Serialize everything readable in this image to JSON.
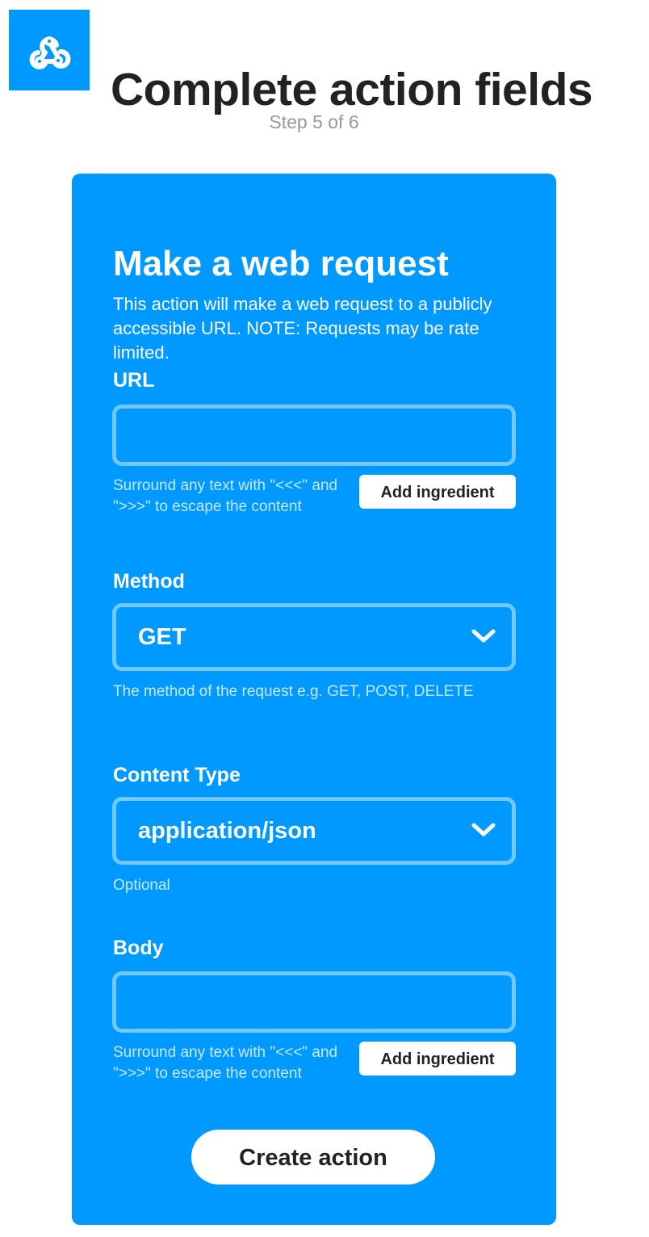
{
  "header": {
    "logo_icon": "webhooks-icon",
    "title": "Complete action fields",
    "step": "Step 5 of 6"
  },
  "colors": {
    "brand_blue": "#0099ff",
    "white": "#ffffff",
    "title_text": "#222222",
    "muted_text": "#999999"
  },
  "action": {
    "title": "Make a web request",
    "description": "This action will make a web request to a publicly accessible URL. NOTE: Requests may be rate limited."
  },
  "fields": {
    "url": {
      "label": "URL",
      "value": "",
      "helper": "Surround any text with \"<<<\" and \">>>\" to escape the content",
      "ingredient_button": "Add ingredient"
    },
    "method": {
      "label": "Method",
      "value": "GET",
      "helper": "The method of the request e.g. GET, POST, DELETE",
      "icon": "chevron-down-icon"
    },
    "content_type": {
      "label": "Content Type",
      "value": "application/json",
      "helper": "Optional",
      "icon": "chevron-down-icon"
    },
    "body": {
      "label": "Body",
      "value": "",
      "helper": "Surround any text with \"<<<\" and \">>>\" to escape the content",
      "ingredient_button": "Add ingredient"
    }
  },
  "submit": {
    "label": "Create action"
  }
}
